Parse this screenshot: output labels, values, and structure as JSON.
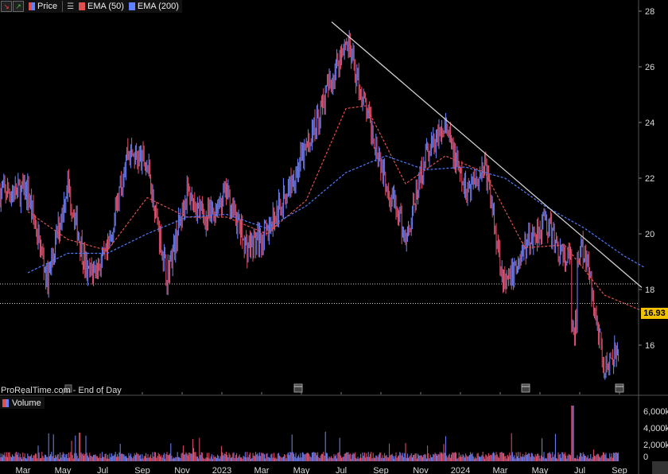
{
  "legend": {
    "price_label": "Price",
    "ema50_label": "EMA (50)",
    "ema200_label": "EMA (200)",
    "volume_label": "Volume",
    "source": "ProRealTime.com - End of Day"
  },
  "colors": {
    "up": "#6f86ff",
    "down": "#e8506a",
    "ema50": "#e05050",
    "ema200": "#4f7bff",
    "trendline": "#d0d0d0",
    "last_price_bg": "#f2c200"
  },
  "icons": [
    "arrow-down-icon",
    "arrow-up-icon",
    "menu-icon",
    "calendar-icon",
    "info-icon"
  ],
  "chart_data": {
    "type": "line",
    "title": "",
    "xlabel": "",
    "ylabel": "",
    "last_price": "16.93",
    "y_ticks": [
      "28",
      "26",
      "24",
      "22",
      "20",
      "18",
      "16"
    ],
    "volume_ticks": [
      "6,000k",
      "4,000k",
      "2,000k",
      "0"
    ],
    "x_ticks": [
      "Mar",
      "May",
      "Jul",
      "Sep",
      "Nov",
      "2023",
      "Mar",
      "May",
      "Jul",
      "Sep",
      "Nov",
      "2024",
      "Mar",
      "May",
      "Jul",
      "Sep"
    ],
    "ylim": [
      14.5,
      28.2
    ],
    "horizontal_levels": [
      18.2,
      17.5
    ],
    "trendline": {
      "from": [
        "2023-07",
        27.1
      ],
      "to": [
        "2024-09",
        18.3
      ]
    },
    "price_path": [
      [
        "2022-03",
        21.5
      ],
      [
        "2022-04",
        18.3
      ],
      [
        "2022-05",
        21.8
      ],
      [
        "2022-06",
        18.5
      ],
      [
        "2022-07",
        19.2
      ],
      [
        "2022-08",
        23.0
      ],
      [
        "2022-09",
        22.5
      ],
      [
        "2022-10",
        18.5
      ],
      [
        "2022-11",
        21.5
      ],
      [
        "2022-12",
        20.5
      ],
      [
        "2023-01",
        21.5
      ],
      [
        "2023-02",
        19.5
      ],
      [
        "2023-03",
        20.0
      ],
      [
        "2023-04",
        21.5
      ],
      [
        "2023-05",
        23.0
      ],
      [
        "2023-06",
        25.0
      ],
      [
        "2023-07",
        27.0
      ],
      [
        "2023-08",
        24.5
      ],
      [
        "2023-09",
        22.0
      ],
      [
        "2023-10",
        19.8
      ],
      [
        "2023-11",
        22.8
      ],
      [
        "2023-12",
        23.8
      ],
      [
        "2024-01",
        21.5
      ],
      [
        "2024-02",
        22.5
      ],
      [
        "2024-03",
        18.0
      ],
      [
        "2024-04",
        19.5
      ],
      [
        "2024-05",
        20.5
      ],
      [
        "2024-06",
        19.0
      ],
      [
        "2024-07",
        19.5
      ],
      [
        "2024-08",
        15.2
      ],
      [
        "2024-09",
        16.5
      ],
      [
        "2024-10",
        16.93
      ]
    ],
    "series": [
      {
        "name": "EMA (50)",
        "values": [
          [
            "2022-03",
            20.8
          ],
          [
            "2022-05",
            19.8
          ],
          [
            "2022-07",
            19.4
          ],
          [
            "2022-09",
            21.3
          ],
          [
            "2022-11",
            20.6
          ],
          [
            "2023-01",
            20.6
          ],
          [
            "2023-03",
            20.0
          ],
          [
            "2023-05",
            21.2
          ],
          [
            "2023-07",
            24.5
          ],
          [
            "2023-08",
            24.6
          ],
          [
            "2023-10",
            21.8
          ],
          [
            "2023-12",
            22.8
          ],
          [
            "2024-02",
            22.2
          ],
          [
            "2024-04",
            19.5
          ],
          [
            "2024-06",
            19.6
          ],
          [
            "2024-08",
            17.8
          ],
          [
            "2024-10",
            17.2
          ]
        ]
      },
      {
        "name": "EMA (200)",
        "values": [
          [
            "2022-03",
            18.6
          ],
          [
            "2022-05",
            19.3
          ],
          [
            "2022-07",
            19.3
          ],
          [
            "2022-09",
            20.0
          ],
          [
            "2022-11",
            20.6
          ],
          [
            "2023-01",
            20.7
          ],
          [
            "2023-03",
            20.2
          ],
          [
            "2023-05",
            21.0
          ],
          [
            "2023-07",
            22.2
          ],
          [
            "2023-09",
            22.8
          ],
          [
            "2023-11",
            22.3
          ],
          [
            "2024-01",
            22.4
          ],
          [
            "2024-03",
            22.0
          ],
          [
            "2024-05",
            21.0
          ],
          [
            "2024-07",
            20.2
          ],
          [
            "2024-09",
            19.2
          ],
          [
            "2024-10",
            18.8
          ]
        ]
      }
    ]
  }
}
